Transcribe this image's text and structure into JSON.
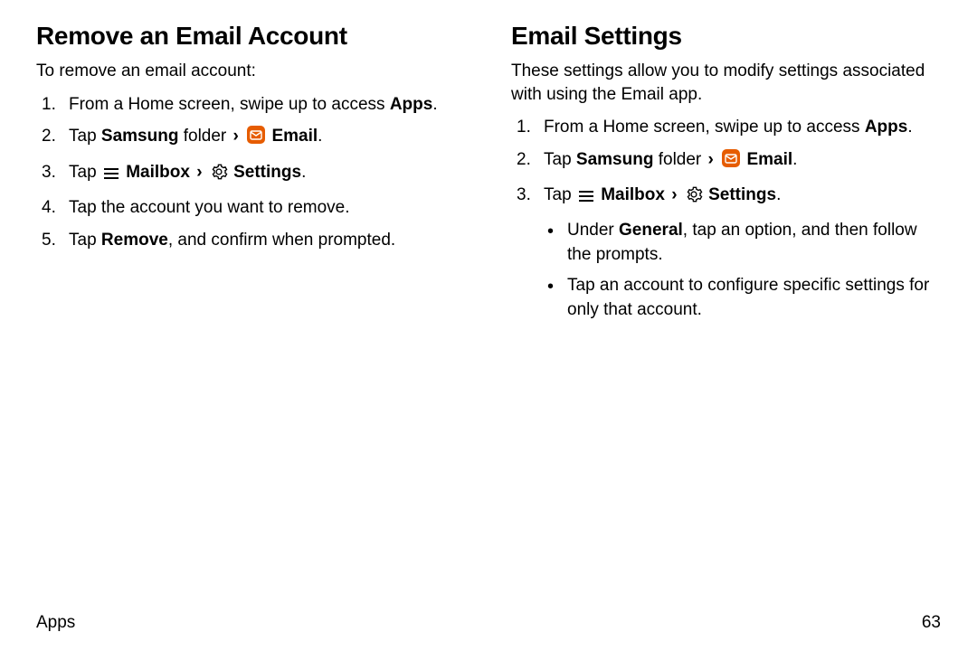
{
  "left": {
    "heading": "Remove an Email Account",
    "intro": "To remove an email account:",
    "step1_a": "From a Home screen, swipe up to access ",
    "step1_b": "Apps",
    "step1_c": ".",
    "step2_a": "Tap ",
    "step2_b": "Samsung",
    "step2_c": " folder ",
    "step2_d": " Email",
    "step2_e": ".",
    "step3_a": "Tap ",
    "step3_b": " Mailbox ",
    "step3_c": " Settings",
    "step3_d": ".",
    "step4": "Tap the account you want to remove.",
    "step5_a": "Tap ",
    "step5_b": "Remove",
    "step5_c": ", and confirm when prompted."
  },
  "right": {
    "heading": "Email Settings",
    "intro": "These settings allow you to modify settings associated with using the Email app.",
    "step1_a": "From a Home screen, swipe up to access ",
    "step1_b": "Apps",
    "step1_c": ".",
    "step2_a": "Tap ",
    "step2_b": "Samsung",
    "step2_c": " folder ",
    "step2_d": " Email",
    "step2_e": ".",
    "step3_a": "Tap ",
    "step3_b": " Mailbox ",
    "step3_c": " Settings",
    "step3_d": ".",
    "bullet1_a": "Under ",
    "bullet1_b": "General",
    "bullet1_c": ", tap an option, and then follow the prompts.",
    "bullet2": "Tap an account to configure specific settings for only that account."
  },
  "footer": {
    "section": "Apps",
    "page": "63"
  },
  "glyphs": {
    "chevron": "›"
  }
}
